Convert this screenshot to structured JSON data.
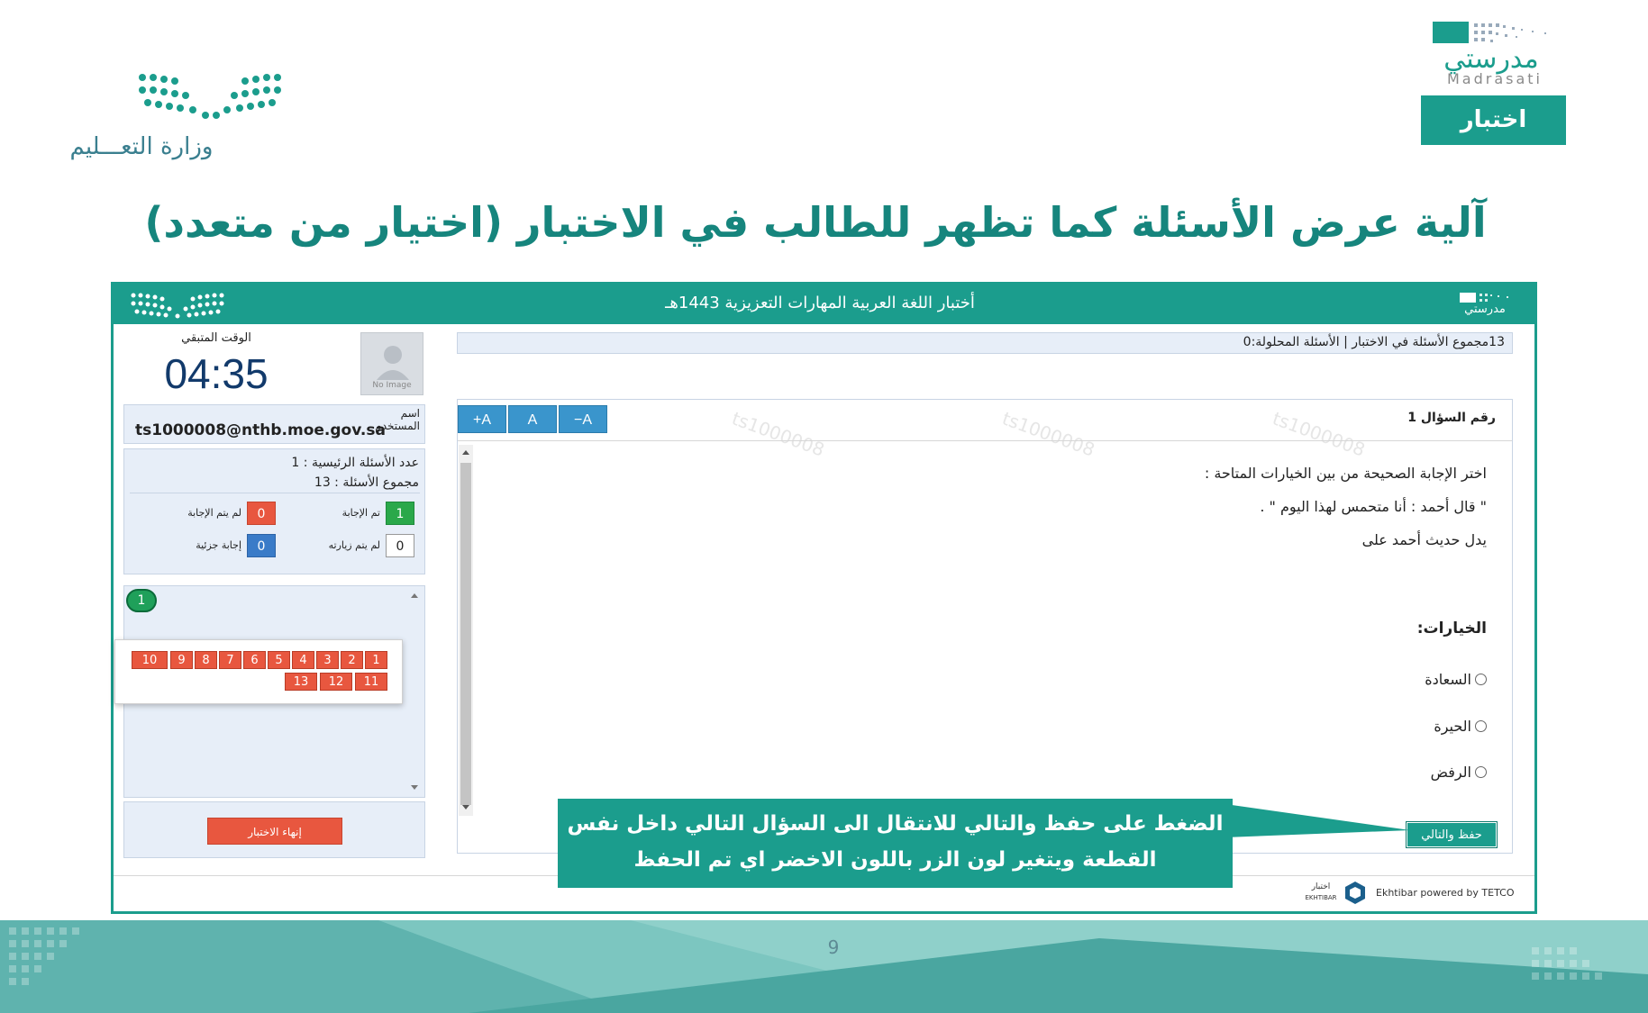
{
  "slide": {
    "ministry_name": "وزارة التعـــليم",
    "madrasati_ar": "مدرستي",
    "madrasati_en": "Madrasati",
    "badge": "اختبار",
    "title": "آلية عرض الأسئلة كما تظهر للطالب في الاختبار (اختيار من متعدد)",
    "page_number": "9"
  },
  "exam": {
    "header_title": "أختبار اللغة العربية المهارات التعزيزية 1443هـ",
    "header_logo_text": "مدرستي",
    "timer_label": "الوقت المتبقي",
    "timer": "04:35",
    "avatar_label": "No Image",
    "user_label": "اسم المستخدم",
    "user_email": "ts1000008@nthb.moe.gov.sa",
    "main_questions": "عدد الأسئلة الرئيسية : 1",
    "total_questions": "مجموع الأسئلة : 13",
    "counters": {
      "answered_label": "تم الإجابة",
      "answered": "1",
      "unanswered_label": "لم يتم الإجابة",
      "unanswered": "0",
      "not_visited_label": "لم يتم زيارته",
      "not_visited": "0",
      "partial_label": "إجابة جزئية",
      "partial": "0"
    },
    "passage_label": "1",
    "question_numbers": [
      "1",
      "2",
      "3",
      "4",
      "5",
      "6",
      "7",
      "8",
      "9",
      "10",
      "11",
      "12",
      "13"
    ],
    "end_button": "إنهاء الاختبار",
    "count_bar": "13مجموع الأسئلة في الاختبار | الأسئلة المحلولة:0",
    "font_buttons": [
      "+A",
      "A",
      "−A"
    ],
    "question_no": "رقم السؤال 1",
    "question_lines": [
      "اختر الإجابة الصحيحة من بين الخيارات المتاحة :",
      "\" قال أحمد : أنا متحمس لهذا اليوم \" .",
      "يدل حديث أحمد على"
    ],
    "choices_title": "الخيارات:",
    "choices": [
      "السعادة",
      "الحيرة",
      "الرفض"
    ],
    "save_button": "حفظ والتالي",
    "footer": "Ekhtibar powered by TETCO",
    "footer_logo_ar": "اختبار",
    "footer_logo_en": "EKHTIBAR",
    "watermark": "ts1000008"
  },
  "callout": {
    "line1": "الضغط على حفظ والتالي للانتقال الى السؤال التالي داخل نفس",
    "line2": "القطعة ويتغير لون الزر باللون الاخضر اي تم الحفظ"
  },
  "colors": {
    "brand_teal": "#1b9d8d",
    "answered_green": "#2aa84a",
    "unanswered_red": "#e8573f",
    "partial_blue": "#3a7bc8"
  }
}
